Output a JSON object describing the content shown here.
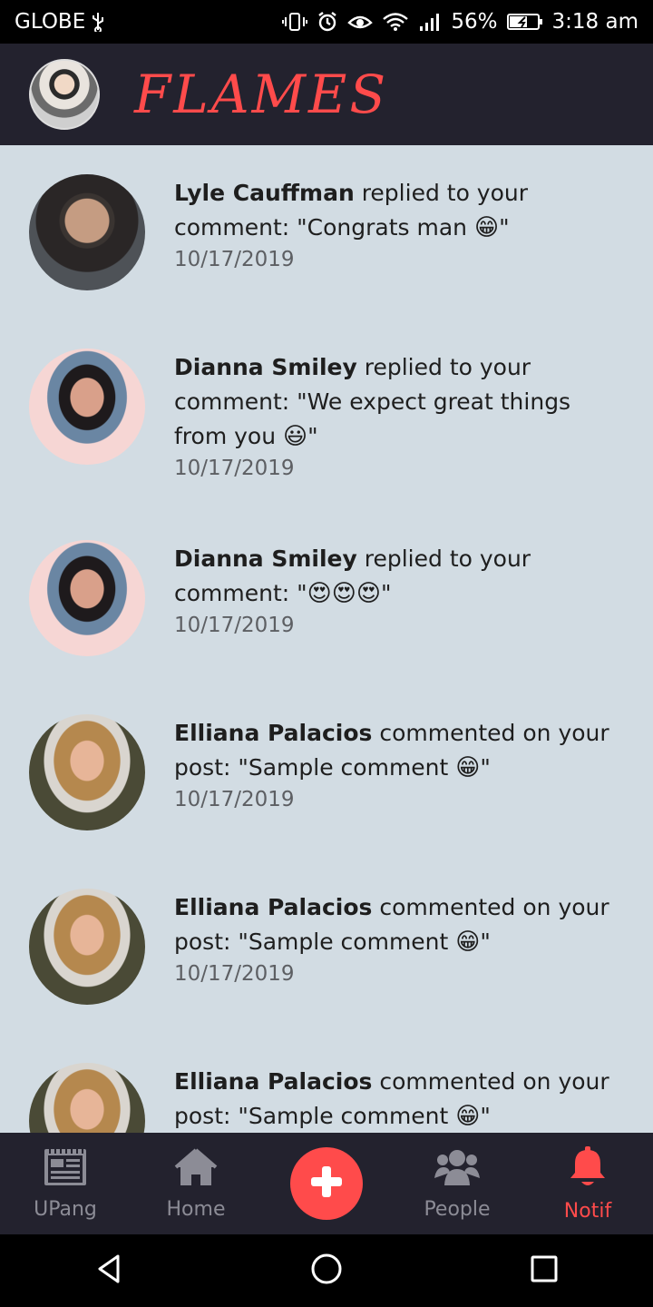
{
  "status_bar": {
    "carrier": "GLOBE",
    "battery": "56%",
    "time": "3:18 am"
  },
  "header": {
    "title": "FLAMES",
    "accent_color": "#ff4b4b"
  },
  "notifications": [
    {
      "name": "Lyle Cauffman",
      "action": " replied to your comment: \"Congrats man ",
      "emoji": "😁",
      "end": "\"",
      "date": "10/17/2019",
      "avatar": "male"
    },
    {
      "name": "Dianna Smiley",
      "action": " replied to your comment: \"We expect great things from you ",
      "emoji": "😃",
      "end": "\"",
      "date": "10/17/2019",
      "avatar": "dianna"
    },
    {
      "name": "Dianna Smiley",
      "action": " replied to your comment: \"",
      "emoji": "😍😍😍",
      "end": "\"",
      "date": "10/17/2019",
      "avatar": "dianna"
    },
    {
      "name": "Elliana Palacios",
      "action": " commented on your post: \"Sample comment ",
      "emoji": "😁",
      "end": "\"",
      "date": "10/17/2019",
      "avatar": "elliana"
    },
    {
      "name": "Elliana Palacios",
      "action": " commented on your post: \"Sample comment ",
      "emoji": "😁",
      "end": "\"",
      "date": "10/17/2019",
      "avatar": "elliana"
    },
    {
      "name": "Elliana Palacios",
      "action": " commented on your post: \"Sample comment ",
      "emoji": "😁",
      "end": "\"",
      "date": "",
      "avatar": "elliana"
    }
  ],
  "bottom_nav": {
    "upang": "UPang",
    "home": "Home",
    "people": "People",
    "notif": "Notif"
  }
}
